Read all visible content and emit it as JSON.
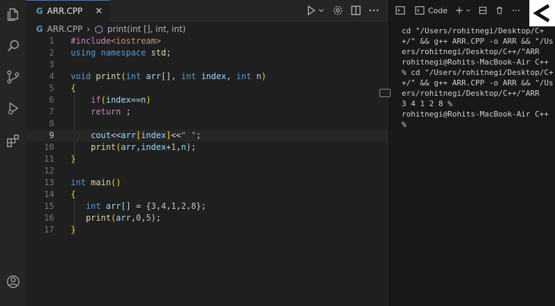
{
  "activity_bar": {
    "icons": [
      "explorer-icon",
      "search-icon",
      "source-control-icon",
      "run-debug-icon",
      "extensions-icon",
      "account-icon"
    ]
  },
  "editor": {
    "tab": {
      "label": "ARR.CPP",
      "close": "✕"
    },
    "breadcrumb": {
      "file": "ARR.CPP",
      "separator": "›",
      "symbol": "print(int [], int, int)"
    },
    "active_line": 9,
    "lines": [
      {
        "n": "1"
      },
      {
        "n": "2"
      },
      {
        "n": "3"
      },
      {
        "n": "4"
      },
      {
        "n": "5"
      },
      {
        "n": "6"
      },
      {
        "n": "7"
      },
      {
        "n": "8"
      },
      {
        "n": "9"
      },
      {
        "n": "10"
      },
      {
        "n": "11"
      },
      {
        "n": "12"
      },
      {
        "n": "13"
      },
      {
        "n": "14"
      },
      {
        "n": "15"
      },
      {
        "n": "16"
      },
      {
        "n": "17"
      }
    ],
    "code": {
      "l1": {
        "a": "#include",
        "b": "<iostream>"
      },
      "l2": {
        "a": "using",
        "b": "namespace",
        "c": "std",
        "d": ";"
      },
      "l4": {
        "a": "void",
        "b": "print",
        "c": "(",
        "d": "int",
        "e": "arr",
        "f": "[]",
        "g": ", ",
        "h": "int",
        "i": "index",
        "j": ", ",
        "k": "int",
        "l": "n",
        "m": ")"
      },
      "l5": "{",
      "l6": {
        "a": "if",
        "b": "(",
        "c": "index",
        "d": "==",
        "e": "n",
        "f": ")"
      },
      "l7": {
        "a": "return",
        "b": " ;"
      },
      "l9": {
        "a": "cout",
        "b": "<<",
        "c": "arr",
        "d": "[",
        "e": "index",
        "f": "]",
        "g": "<<",
        "h": "\" \"",
        "i": ";"
      },
      "l10": {
        "a": "print",
        "b": "(",
        "c": "arr",
        "d": ",",
        "e": "index",
        "f": "+",
        "g": "1",
        "h": ",",
        "i": "n",
        "j": ");"
      },
      "l11": "}",
      "l13": {
        "a": "int",
        "b": "main",
        "c": "()"
      },
      "l14": "{",
      "l15": {
        "a": "int",
        "b": "arr",
        "c": "[] = {",
        "d": "3",
        "e": ",",
        "f": "4",
        "g": ",",
        "h": "1",
        "i": ",",
        "j": "2",
        "k": ",",
        "l": "8",
        "m": "};"
      },
      "l16": {
        "a": "print",
        "b": "(",
        "c": "arr",
        "d": ",",
        "e": "0",
        "f": ",",
        "g": "5",
        "h": ");"
      },
      "l17": "}"
    }
  },
  "terminal": {
    "tab_label": "Code",
    "output": "cd \"/Users/rohitnegi/Desktop/C++/\" && g++ ARR.CPP -o ARR && \"/Users/rohitnegi/Desktop/C++/\"ARR\nrohitnegi@Rohits-MacBook-Air C++ % cd \"/Users/rohitnegi/Desktop/C++/\" && g++ ARR.CPP -o ARR && \"/Users/rohitnegi/Desktop/C++/\"ARR\n3 4 1 2 8 %\nrohitnegi@Rohits-MacBook-Air C++ %"
  },
  "colors": {
    "accent": "#3c7dd9",
    "background": "#1e1e1e"
  }
}
